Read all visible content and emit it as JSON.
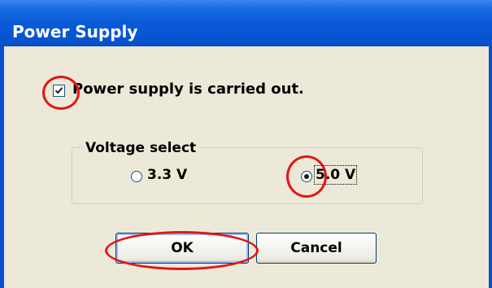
{
  "window": {
    "title": "Power Supply"
  },
  "power_checkbox": {
    "label": "Power supply is carried out.",
    "checked": true
  },
  "voltage_group": {
    "label": "Voltage select",
    "options": [
      {
        "label": "3.3 V",
        "selected": false
      },
      {
        "label": "5.0 V",
        "selected": true
      }
    ]
  },
  "buttons": {
    "ok_label": "OK",
    "cancel_label": "Cancel"
  },
  "colors": {
    "titlebar": "#0a5bd6",
    "dialog_background": "#ece9d8",
    "annotation": "#e21515"
  }
}
